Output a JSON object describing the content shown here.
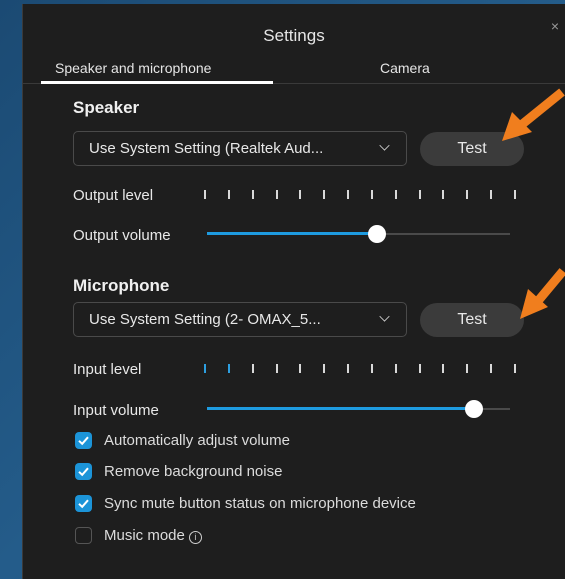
{
  "dialog": {
    "title": "Settings",
    "close_glyph": "×"
  },
  "tabs": [
    {
      "label": "Speaker and microphone",
      "selected": true
    },
    {
      "label": "Camera",
      "selected": false
    }
  ],
  "speaker": {
    "title": "Speaker",
    "device": "Use System Setting (Realtek Aud...",
    "test_label": "Test",
    "output_level_label": "Output level",
    "output_level_active": 0,
    "output_volume_label": "Output volume",
    "output_volume": 0.56
  },
  "microphone": {
    "title": "Microphone",
    "device": "Use System Setting (2- OMAX_5...",
    "test_label": "Test",
    "input_level_label": "Input level",
    "input_level_active": 2,
    "input_volume_label": "Input volume",
    "input_volume": 0.88
  },
  "options": [
    {
      "label": "Automatically adjust volume",
      "checked": true
    },
    {
      "label": "Remove background noise",
      "checked": true
    },
    {
      "label": "Sync mute button status on microphone device",
      "checked": true
    },
    {
      "label": "Music mode",
      "checked": false,
      "info_icon": "info-icon"
    }
  ],
  "colors": {
    "accent": "#1e9be0",
    "annotation_arrow": "#f07e1e",
    "background": "#1e1e1e"
  }
}
